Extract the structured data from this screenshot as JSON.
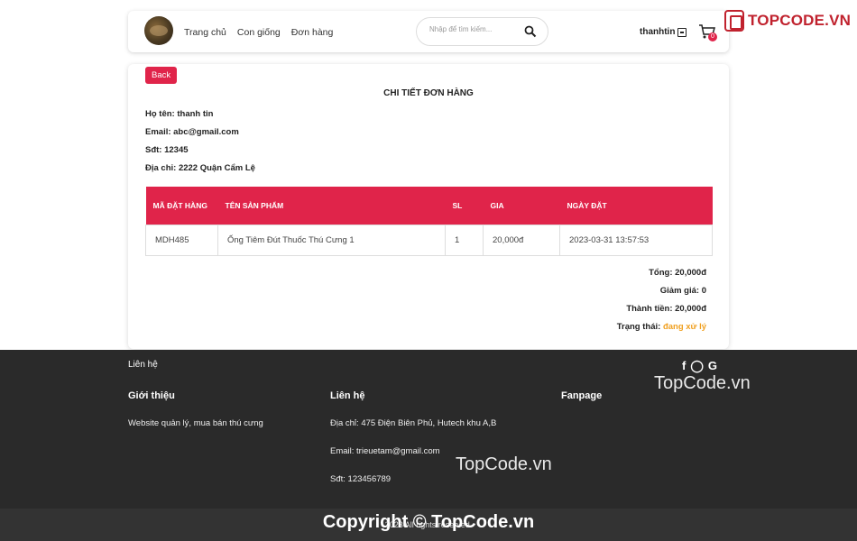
{
  "nav": {
    "links": [
      "Trang chủ",
      "Con giống",
      "Đơn hàng"
    ],
    "search_placeholder": "Nhập để tìm kiếm...",
    "username": "thanhtin",
    "cart_count": "0"
  },
  "brand": {
    "text": "TOPCODE.VN"
  },
  "order": {
    "back_label": "Back",
    "title": "CHI TIẾT ĐƠN HÀNG",
    "name": "Họ tên: thanh tin",
    "email": "Email: abc@gmail.com",
    "phone": "Sđt: 12345",
    "address": "Địa chỉ: 2222 Quận Cẩm Lệ",
    "columns": [
      "MÃ ĐẶT HÀNG",
      "TÊN SẢN PHẨM",
      "SL",
      "GIA",
      "NGÀY ĐẶT"
    ],
    "rows": [
      [
        "MDH485",
        "Ống Tiêm Đút Thuốc Thú Cưng 1",
        "1",
        "20,000đ",
        "2023-03-31 13:57:53"
      ]
    ],
    "total": "Tổng: 20,000đ",
    "discount": "Giảm giá: 0",
    "final": "Thành tiền: 20,000đ",
    "status_label": "Trạng thái: ",
    "status_value": "đang xử lý"
  },
  "footer": {
    "contact_link": "Liên hệ",
    "social": [
      "f",
      "◯",
      "G"
    ],
    "watermark": "TopCode.vn",
    "about_head": "Giới thiệu",
    "about_text": "Website quản lý, mua bán thú cưng",
    "contact_head": "Liên hệ",
    "address": "Địa chỉ: 475 Điện Biên Phủ, Hutech khu A,B",
    "email": "Email: trieuetam@gmail.com",
    "phone": "Sđt: 123456789",
    "fanpage_head": "Fanpage",
    "copyright_wm": "Copyright © TopCode.vn",
    "rights": "2023 All rights reserved."
  },
  "colors": {
    "accent": "#e0244a",
    "status": "#f0a020",
    "footer_bg": "#2a2a2a"
  }
}
